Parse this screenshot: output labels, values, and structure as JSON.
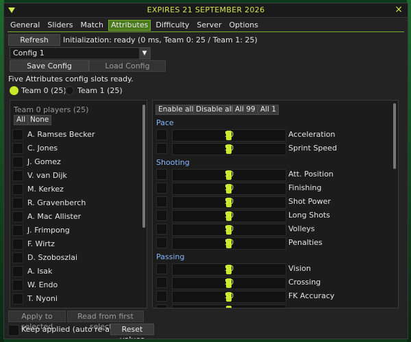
{
  "window": {
    "title": "EXPIRES 21 SEPTEMBER 2026",
    "close_icon": "×"
  },
  "tabs": [
    {
      "label": "General"
    },
    {
      "label": "Sliders"
    },
    {
      "label": "Match"
    },
    {
      "label": "Attributes",
      "active": true
    },
    {
      "label": "Difficulty"
    },
    {
      "label": "Server"
    },
    {
      "label": "Options"
    }
  ],
  "toolbar": {
    "refresh_label": "Refresh players",
    "init_status": "Initialization: ready (0 ms, Team 0: 25 / Team 1: 25)"
  },
  "config": {
    "selected": "Config 1",
    "save_label": "Save Config",
    "load_label": "Load Config",
    "status": "Five Attributes config slots ready."
  },
  "teams": {
    "team0_label": "Team 0 (25)",
    "team1_label": "Team 1 (25)",
    "selected": 0
  },
  "players_panel": {
    "header": "Team 0 players (25)",
    "all_label": "All",
    "none_label": "None",
    "players": [
      "A. Ramses Becker",
      "C. Jones",
      "J. Gomez",
      "V. van Dijk",
      "M. Kerkez",
      "R. Gravenberch",
      "A. Mac Allister",
      "J. Frimpong",
      "F. Wirtz",
      "D. Szoboszlai",
      "A. Isak",
      "W. Endo",
      "T. Nyoni"
    ]
  },
  "attributes_panel": {
    "enable_all": "Enable all",
    "disable_all": "Disable all",
    "all99": "All 99",
    "all1": "All 1",
    "sections": [
      {
        "name": "Pace",
        "items": [
          {
            "label": "Acceleration",
            "value": "50"
          },
          {
            "label": "Sprint Speed",
            "value": "50"
          }
        ]
      },
      {
        "name": "Shooting",
        "items": [
          {
            "label": "Att. Position",
            "value": "50"
          },
          {
            "label": "Finishing",
            "value": "50"
          },
          {
            "label": "Shot Power",
            "value": "50"
          },
          {
            "label": "Long Shots",
            "value": "50"
          },
          {
            "label": "Volleys",
            "value": "50"
          },
          {
            "label": "Penalties",
            "value": "50"
          }
        ]
      },
      {
        "name": "Passing",
        "items": [
          {
            "label": "Vision",
            "value": "50"
          },
          {
            "label": "Crossing",
            "value": "50"
          },
          {
            "label": "FK Accuracy",
            "value": "50"
          }
        ]
      }
    ]
  },
  "footer": {
    "apply_label": "Apply to selected",
    "read_label": "Read from first selected",
    "keep_label": "Keep applied (auto re-apply)",
    "reset_label": "Reset values"
  },
  "colors": {
    "accent": "#c8e82a",
    "title": "#d4e74e",
    "section": "#86b7ff",
    "tab_active": "#4a7a1c"
  }
}
